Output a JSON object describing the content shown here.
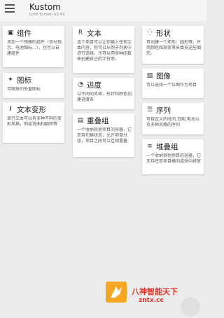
{
  "header": {
    "app_title": "Kustom",
    "app_subtitle": "Lock Screen v3.43"
  },
  "cards": [
    {
      "icon": "komponent-icon",
      "title": "组件",
      "desc": "添加一个预建的组件（信号指示、电池图标…），也可以自建组件"
    },
    {
      "icon": "text-icon",
      "title": "文本",
      "desc": "这个项目可以让你输入任何文本内容，你可以从例子列表中进行选择，也可以用各种函数来创建自己的字符串。"
    },
    {
      "icon": "shape-icon",
      "title": "形状",
      "desc": "可创建一个矩形、圆形等，并用颜色和渐变等来填充这些图形。"
    },
    {
      "icon": "puzzle-icon",
      "title": "图标",
      "desc": "可缩放的矢量图标"
    },
    {
      "icon": "progress-icon",
      "title": "进度",
      "desc": "以不同的风格，形状和颜色创建进度条"
    },
    {
      "icon": "image-icon",
      "title": "图像",
      "desc": "可以选择一个位图作为项目"
    },
    {
      "icon": "fonticon-icon",
      "title": "文本变形",
      "desc": "单行文本可以有多种不同的变形风格，例如弯曲和翻转等"
    },
    {
      "icon": "overlap-icon",
      "title": "重叠组",
      "desc": "一个收纳其他项目的容器，它支持切换状态，允许项目分组，项目之间可以互相重叠"
    },
    {
      "icon": "series-icon",
      "title": "序列",
      "desc": "可自定义的时间,日期,电池以及多种风格的序列"
    },
    {
      "icon": "stack-icon",
      "title": "堆叠组",
      "desc": "一个收纳其他项目的容器，它支持任意项目横向或纵向排放"
    }
  ],
  "ad": {
    "line1": "八神智能天下",
    "line2": "zntx.cc"
  }
}
